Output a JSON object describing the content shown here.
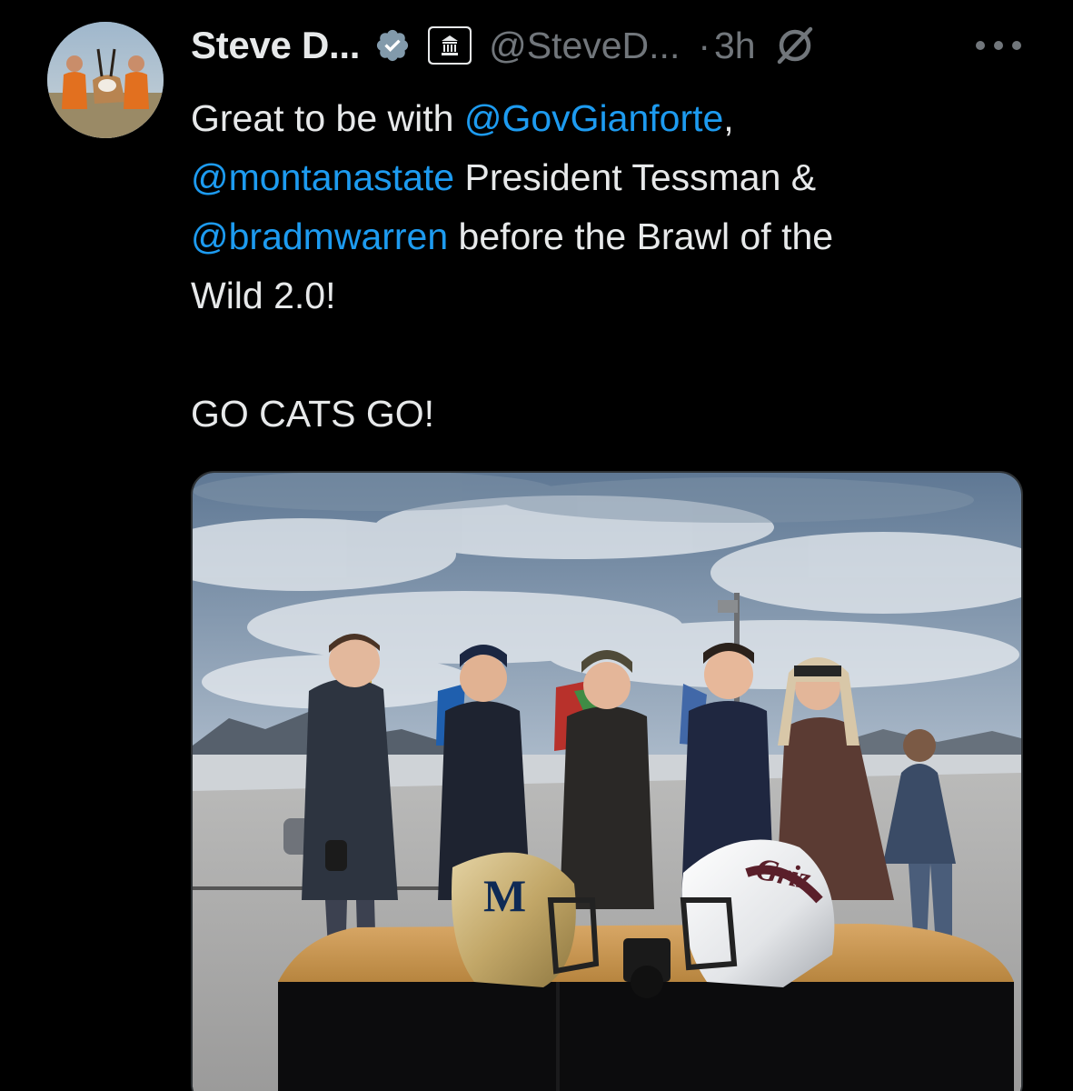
{
  "author": {
    "display_name": "Steve D...",
    "handle": "@SteveD...",
    "separator": "·",
    "timestamp": "3h",
    "avatar_icon": "avatar",
    "verified_icon": "verified-badge-icon",
    "affiliation_icon": "government-building-icon",
    "grok_icon": "grok-icon",
    "more_icon": "more-options-icon"
  },
  "tweet": {
    "segments": [
      {
        "text": "Great to be with ",
        "type": "text"
      },
      {
        "text": "@GovGianforte",
        "type": "mention"
      },
      {
        "text": ",",
        "type": "text"
      },
      {
        "text": "@montanastate",
        "type": "mention"
      },
      {
        "text": " President Tessman &",
        "type": "text"
      },
      {
        "text": "@bradmwarren",
        "type": "mention"
      },
      {
        "text": " before the Brawl of the",
        "type": "text"
      },
      {
        "text": "Wild 2.0!",
        "type": "text"
      },
      {
        "text": "GO CATS GO!",
        "type": "text"
      }
    ]
  },
  "media": {
    "description_icon": "photo",
    "helmet_left_logo": "M",
    "helmet_right_logo": "Griz"
  },
  "colors": {
    "background": "#000000",
    "primary_text": "#e7e9ea",
    "secondary_text": "#71767b",
    "mention": "#1d9bf0",
    "verified_badge": "#829aab"
  }
}
